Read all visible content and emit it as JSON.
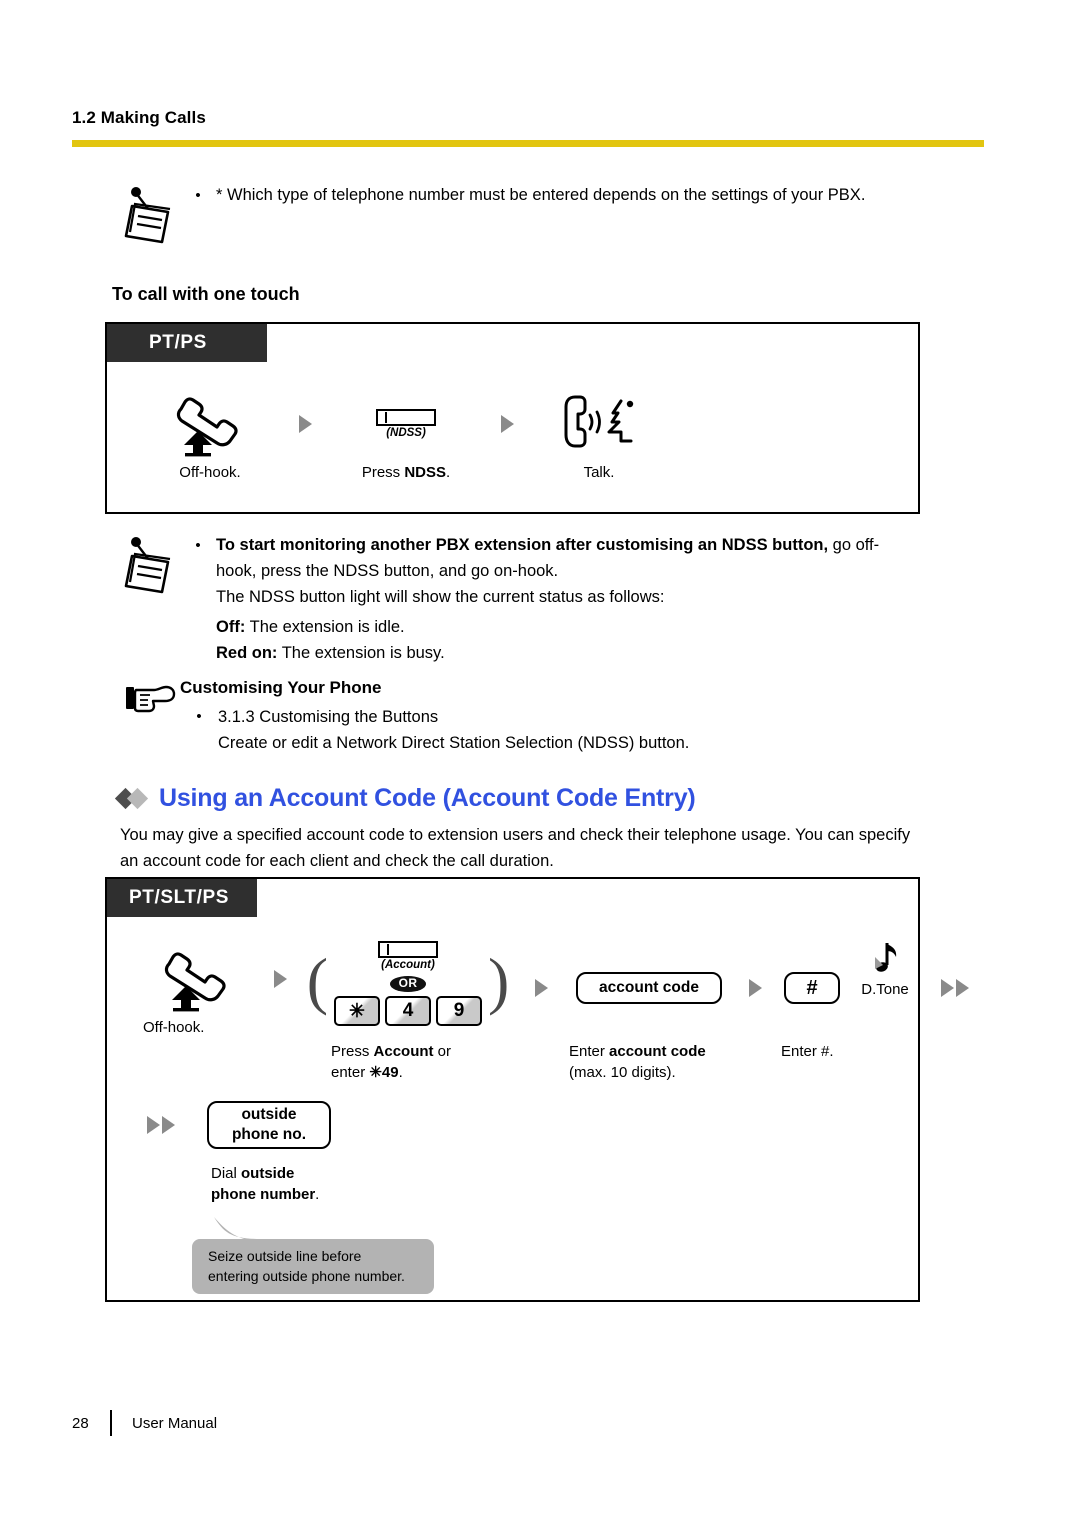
{
  "header": {
    "section": "1.2 Making Calls",
    "rule_color": "#e2c510"
  },
  "note_top": {
    "bullet": "•",
    "icon": "note-pin-icon",
    "text": "* Which type of telephone number must be entered depends on the settings of your PBX."
  },
  "subheading_one_touch": "To call with one touch",
  "box_pt_ps": {
    "tab_label": "PT/PS",
    "steps": [
      {
        "art": "offhook-handset-icon",
        "label": "Off-hook."
      },
      {
        "art": "phone-button-icon",
        "button_caption": "(NDSS)",
        "label_pre": "Press ",
        "label_bold": "NDSS",
        "label_post": "."
      },
      {
        "art": "talk-handset-face-icon",
        "label": "Talk."
      }
    ]
  },
  "note_ndss": {
    "bullet": "•",
    "icon": "note-pin-icon",
    "line1_bold": "To start monitoring another PBX extension after customising an NDSS button,",
    "line1_rest": " go off-",
    "line2": "hook, press the NDSS button, and go on-hook.",
    "line3": "The NDSS button light will show the current status as follows:",
    "status_off_label": "Off:",
    "status_off_text": " The extension is idle.",
    "status_red_label": "Red on:",
    "status_red_text": " The extension is busy."
  },
  "customising": {
    "icon": "pointing-hand-icon",
    "title": "Customising Your Phone",
    "bullet": "•",
    "item": "3.1.3 Customising the Buttons",
    "item_desc": "Create or edit a Network Direct Station Selection (NDSS) button."
  },
  "account_section": {
    "heading": "Using an Account Code (Account Code Entry)",
    "heading_color": "#3151e0",
    "paragraph_line1": "You may give a specified account code to extension users and check their telephone usage. You can specify",
    "paragraph_line2": "an account code for each client and check the call duration."
  },
  "box_pt_slt_ps": {
    "tab_label": "PT/SLT/PS",
    "step1": {
      "art": "offhook-handset-icon",
      "label": "Off-hook."
    },
    "step2": {
      "button_caption": "(Account)",
      "or_badge": "OR",
      "keys": [
        "✳",
        "4",
        "9"
      ],
      "label_pre": "Press ",
      "label_bold": "Account",
      "label_post": " or",
      "label_line2_pre": "enter ",
      "label_line2_bold": "✳49",
      "label_line2_post": "."
    },
    "step3": {
      "pill": "account code",
      "label_pre": "Enter ",
      "label_bold": "account code",
      "label_line2": "(max. 10 digits)."
    },
    "step4": {
      "pill": "#",
      "tone_icon": "dial-tone-note-icon",
      "tone_label": "D.Tone",
      "label": "Enter #."
    },
    "step5": {
      "pill_line1": "outside",
      "pill_line2": "phone no.",
      "label_pre": "Dial ",
      "label_bold": "outside",
      "label_line2_bold": "phone number",
      "label_line2_post": "."
    },
    "callout": {
      "line1": "Seize outside line before",
      "line2": "entering outside phone number.",
      "color": "#b3b3b3"
    }
  },
  "footer": {
    "page_number": "28",
    "label": "User Manual"
  }
}
